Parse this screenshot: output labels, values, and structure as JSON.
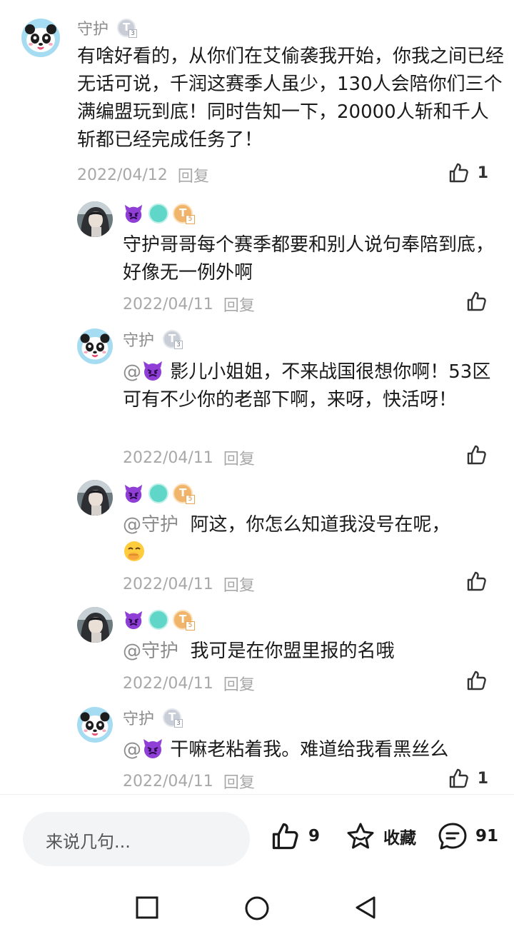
{
  "comments": [
    {
      "user": "守护",
      "text": "有啥好看的，从你们在艾偷袭我开始，你我之间已经无话可说，千润这赛季人虽少，130人会陪你们三个满编盟玩到底！同时告知一下，20000人斩和千人斩都已经完成任务了！",
      "date": "2022/04/12",
      "reply_label": "回复",
      "likes": "1"
    }
  ],
  "replies": [
    {
      "user": "",
      "text": "守护哥哥每个赛季都要和别人说句奉陪到底，好像无一例外啊",
      "date": "2022/04/11",
      "reply_label": "回复",
      "likes": ""
    },
    {
      "user": "守护",
      "mention": "@",
      "text": "影儿小姐姐，不来战国很想你啊！53区可有不少你的老部下啊，来呀，快活呀！",
      "date": "2022/04/11",
      "reply_label": "回复",
      "likes": ""
    },
    {
      "user": "",
      "mention": "@守护",
      "text": "阿这，你怎么知道我没号在呢，",
      "date": "2022/04/11",
      "reply_label": "回复",
      "likes": ""
    },
    {
      "user": "",
      "mention": "@守护",
      "text": "我可是在你盟里报的名哦",
      "date": "2022/04/11",
      "reply_label": "回复",
      "likes": ""
    },
    {
      "user": "守护",
      "mention": "@",
      "text": "干嘛老粘着我。难道给我看黑丝么",
      "date": "2022/04/11",
      "reply_label": "回复",
      "likes": "1"
    }
  ],
  "bottom_bar": {
    "input_placeholder": "来说几句...",
    "like_count": "9",
    "favorite_label": "收藏",
    "comment_count": "91"
  },
  "badges": {
    "level_main": "3",
    "level_gold": "5"
  },
  "icons": [
    "thumbs-up-icon",
    "star-icon",
    "comment-bubble-icon",
    "square-nav-icon",
    "circle-nav-icon",
    "triangle-back-icon",
    "purple-devil-emoji",
    "covering-mouth-emoji"
  ]
}
